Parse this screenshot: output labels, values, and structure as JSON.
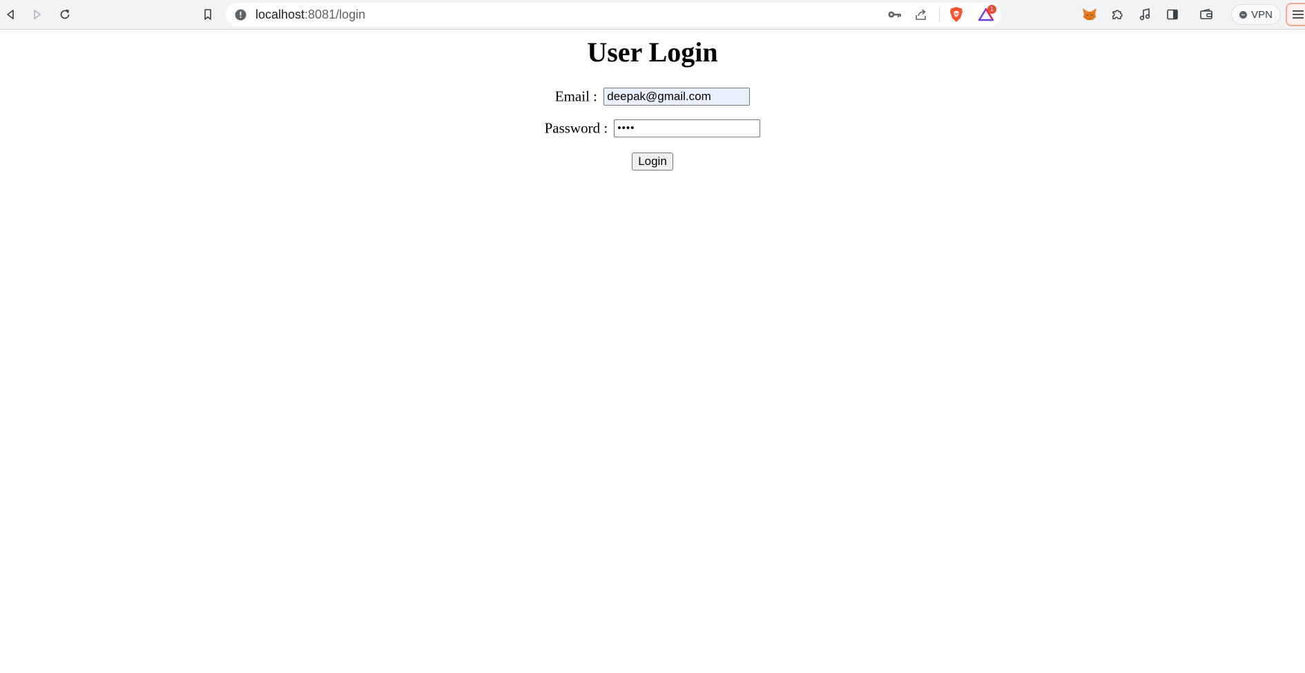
{
  "browser": {
    "url_host": "localhost",
    "url_rest": ":8081/login",
    "rewards_badge": "1",
    "vpn_label": "VPN"
  },
  "icons": {
    "back": "back-icon",
    "forward": "forward-icon",
    "reload": "reload-icon",
    "bookmark": "bookmark-icon",
    "site_info": "site-info-icon",
    "key": "key-icon",
    "share": "share-icon",
    "brave_shields": "brave-shields-icon",
    "brave_rewards": "brave-rewards-icon",
    "metamask": "metamask-fox-icon",
    "extensions": "puzzle-icon",
    "media": "music-note-icon",
    "sidebar": "sidebar-icon",
    "wallet": "wallet-icon",
    "menu": "hamburger-menu-icon"
  },
  "colors": {
    "accent_brave": "#fb542b",
    "autofill_bg": "#e8f0fe",
    "toolbar_bg": "#f1f3f4"
  },
  "page": {
    "title": "User Login",
    "email_label": "Email :",
    "email_value": "deepak@gmail.com",
    "password_label": "Password :",
    "password_value": "••••",
    "login_button": "Login"
  }
}
